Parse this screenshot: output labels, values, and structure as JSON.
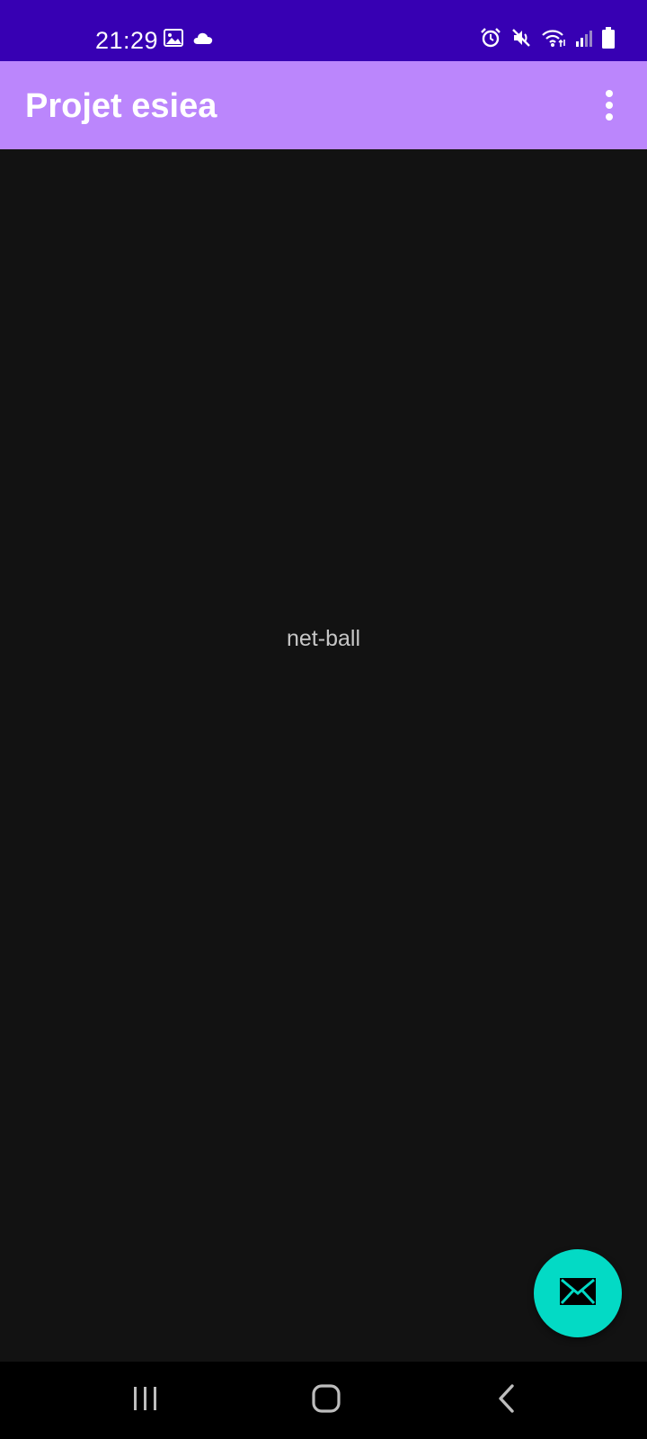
{
  "status_bar": {
    "time": "21:29",
    "left_icons": [
      "image-icon",
      "cloud-icon"
    ],
    "right_icons": [
      "alarm-icon",
      "mute-icon",
      "wifi-icon",
      "signal-icon",
      "battery-icon"
    ],
    "background": "#3700b3"
  },
  "app_bar": {
    "title": "Projet esiea",
    "background": "#bb86fc",
    "menu_icon": "more-vert-icon"
  },
  "content": {
    "text": "net-ball",
    "background": "#121212"
  },
  "fab": {
    "icon": "mail-icon",
    "color": "#03dac5"
  },
  "nav_bar": {
    "buttons": [
      "recents-icon",
      "home-icon",
      "back-icon"
    ]
  }
}
